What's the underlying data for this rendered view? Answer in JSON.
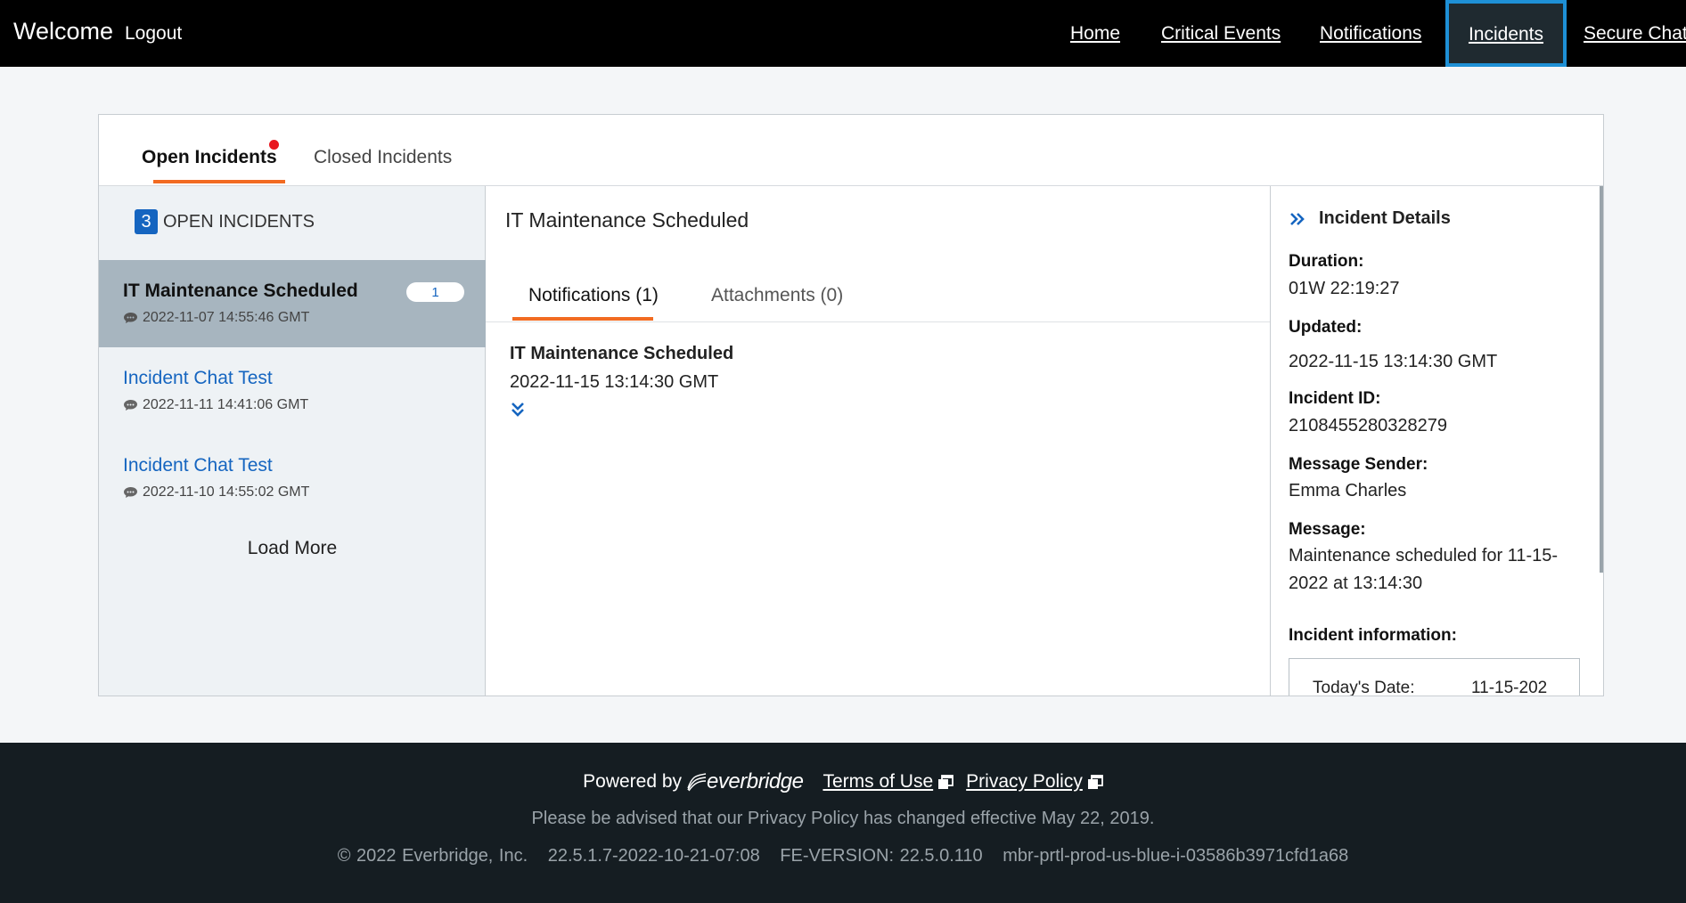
{
  "nav": {
    "welcome": "Welcome",
    "logout": "Logout",
    "links": {
      "home": "Home",
      "critical_events": "Critical Events",
      "notifications": "Notifications",
      "incidents": "Incidents",
      "secure_chat": "Secure Chat"
    },
    "active": "incidents"
  },
  "tabs": {
    "open": "Open Incidents",
    "closed": "Closed Incidents"
  },
  "list": {
    "count": "3",
    "count_label": "OPEN INCIDENTS",
    "items": [
      {
        "title": "IT Maintenance Scheduled",
        "time": "2022-11-07 14:55:46 GMT",
        "badge": "1",
        "selected": true
      },
      {
        "title": "Incident Chat Test",
        "time": "2022-11-11 14:41:06 GMT"
      },
      {
        "title": "Incident Chat Test",
        "time": "2022-11-10 14:55:02 GMT"
      }
    ],
    "load_more": "Load More"
  },
  "middle": {
    "title": "IT Maintenance Scheduled",
    "tabs": {
      "notifications": "Notifications (1)",
      "attachments": "Attachments (0)"
    },
    "notification": {
      "title": "IT Maintenance Scheduled",
      "time": "2022-11-15 13:14:30 GMT"
    }
  },
  "details": {
    "header": "Incident Details",
    "duration_label": "Duration:",
    "duration": "01W 22:19:27",
    "updated_label": "Updated:",
    "updated": "2022-11-15 13:14:30 GMT",
    "id_label": "Incident ID:",
    "id": "2108455280328279",
    "sender_label": "Message Sender:",
    "sender": "Emma Charles",
    "message_label": "Message:",
    "message": "Maintenance scheduled for 11-15-2022 at 13:14:30",
    "info_label": "Incident information:",
    "info_key": "Today's Date:",
    "info_value": "11-15-202"
  },
  "footer": {
    "powered_by": "Powered by",
    "logo": "everbridge",
    "terms": "Terms of Use",
    "privacy": "Privacy Policy",
    "advisory": "Please be advised that our Privacy Policy has changed effective May 22, 2019.",
    "copyright": "© 2022 Everbridge, Inc.",
    "build": "22.5.1.7-2022-10-21-07:08",
    "fe_version": "FE-VERSION: 22.5.0.110",
    "server": "mbr-prtl-prod-us-blue-i-03586b3971cfd1a68"
  },
  "colors": {
    "accent_orange": "#f26b21",
    "link_blue": "#1565c0",
    "active_nav_border": "#1e90d6",
    "notification_dot": "#e8161e"
  }
}
